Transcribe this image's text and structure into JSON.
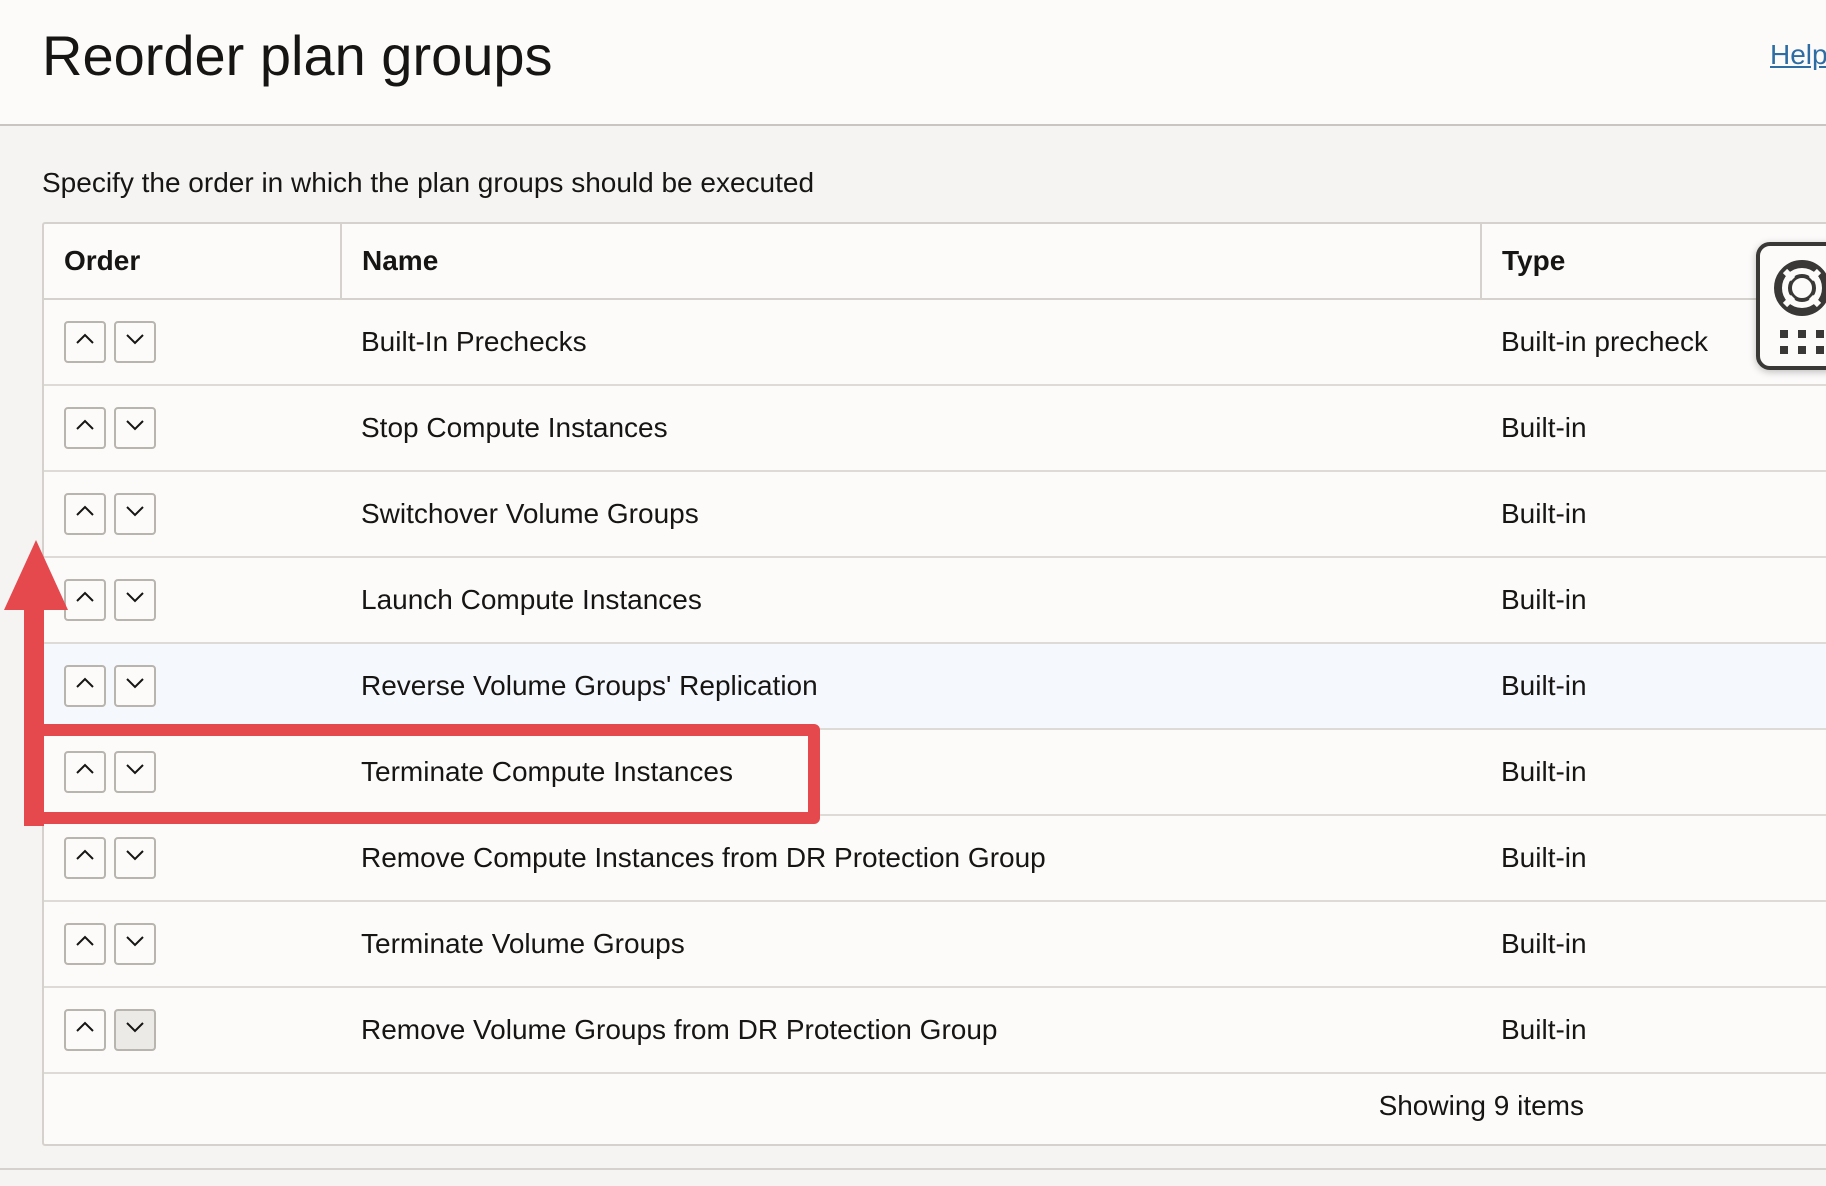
{
  "header": {
    "title": "Reorder plan groups",
    "help_link": "Help"
  },
  "instruction": "Specify the order in which the plan groups should be executed",
  "table": {
    "columns": [
      "Order",
      "Name",
      "Type"
    ],
    "rows": [
      {
        "name": "Built-In Prechecks",
        "type": "Built-in precheck"
      },
      {
        "name": "Stop Compute Instances",
        "type": "Built-in"
      },
      {
        "name": "Switchover Volume Groups",
        "type": "Built-in"
      },
      {
        "name": "Launch Compute Instances",
        "type": "Built-in"
      },
      {
        "name": "Reverse Volume Groups' Replication",
        "type": "Built-in"
      },
      {
        "name": "Terminate Compute Instances",
        "type": "Built-in"
      },
      {
        "name": "Remove Compute Instances from DR Protection Group",
        "type": "Built-in"
      },
      {
        "name": "Terminate Volume Groups",
        "type": "Built-in"
      },
      {
        "name": "Remove Volume Groups from DR Protection Group",
        "type": "Built-in"
      }
    ],
    "footer": "Showing 9 items"
  },
  "icons": {
    "move_up": "chevron-up-icon",
    "move_down": "chevron-down-icon",
    "help_widget": "lifebuoy-icon",
    "apps": "grid-dots-icon"
  },
  "annotation_color": "#e5484d"
}
